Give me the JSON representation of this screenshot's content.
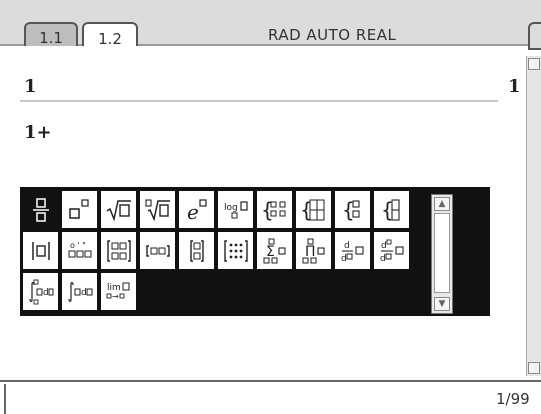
{
  "tabs": [
    {
      "label": "1.1",
      "selected": false
    },
    {
      "label": "1.2",
      "selected": true
    }
  ],
  "mode_text": "RAD AUTO REAL",
  "history": {
    "input": "1",
    "result": "1"
  },
  "entry_line": "1+",
  "status": {
    "page": "1/99"
  },
  "palette": {
    "rows": [
      [
        "fraction",
        "exponent",
        "square-root",
        "nth-root",
        "e-power",
        "log-base",
        "piecewise-2",
        "piecewise-n",
        "system-2",
        "system-n"
      ],
      [
        "absolute-value",
        "degree-minute-second",
        "matrix-2x2",
        "row-vector",
        "column-vector",
        "matrix-mxn",
        "summation",
        "product",
        "derivative",
        "nth-derivative"
      ],
      [
        "definite-integral",
        "indefinite-integral",
        "limit"
      ]
    ],
    "selected": "fraction"
  },
  "colors": {
    "palette_background": "#111111",
    "cell_background": "#ffffff",
    "topbar": "#dcdcdc"
  }
}
